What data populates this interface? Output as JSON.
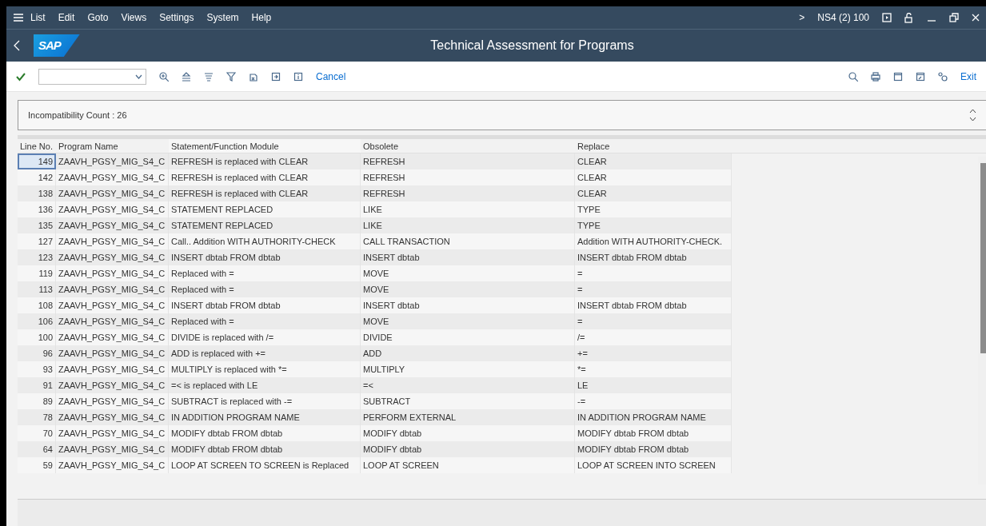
{
  "menu_bar": {
    "items": [
      "List",
      "Edit",
      "Goto",
      "Views",
      "Settings",
      "System",
      "Help"
    ],
    "system_arrow": ">",
    "system_info": "NS4 (2) 100"
  },
  "title_bar": {
    "logo": "SAP",
    "title": "Technical Assessment for Programs"
  },
  "toolbar": {
    "cancel": "Cancel",
    "exit": "Exit"
  },
  "header_panel": {
    "text": "Incompatibility Count : 26"
  },
  "table": {
    "columns": [
      "Line No.",
      "Program Name",
      "Statement/Function Module",
      "Obsolete",
      "Replace"
    ],
    "rows": [
      {
        "cells": [
          "149",
          "ZAAVH_PGSY_MIG_S4_C",
          "REFRESH is replaced with CLEAR",
          "REFRESH",
          "CLEAR"
        ],
        "selected": true
      },
      {
        "cells": [
          "142",
          "ZAAVH_PGSY_MIG_S4_C",
          "REFRESH is replaced with CLEAR",
          "REFRESH",
          "CLEAR"
        ],
        "selected": false
      },
      {
        "cells": [
          "138",
          "ZAAVH_PGSY_MIG_S4_C",
          "REFRESH is replaced with CLEAR",
          "REFRESH",
          "CLEAR"
        ],
        "selected": false
      },
      {
        "cells": [
          "136",
          "ZAAVH_PGSY_MIG_S4_C",
          "STATEMENT REPLACED",
          "LIKE",
          "TYPE"
        ],
        "selected": false
      },
      {
        "cells": [
          "135",
          "ZAAVH_PGSY_MIG_S4_C",
          "STATEMENT REPLACED",
          "LIKE",
          "TYPE"
        ],
        "selected": false
      },
      {
        "cells": [
          "127",
          "ZAAVH_PGSY_MIG_S4_C",
          "Call.. Addition WITH AUTHORITY-CHECK",
          "CALL TRANSACTION",
          "Addition WITH AUTHORITY-CHECK."
        ],
        "selected": false
      },
      {
        "cells": [
          "123",
          "ZAAVH_PGSY_MIG_S4_C",
          "INSERT dbtab FROM dbtab",
          "INSERT dbtab",
          "INSERT dbtab FROM dbtab"
        ],
        "selected": false
      },
      {
        "cells": [
          "119",
          "ZAAVH_PGSY_MIG_S4_C",
          "Replaced with =",
          "MOVE",
          "="
        ],
        "selected": false
      },
      {
        "cells": [
          "113",
          "ZAAVH_PGSY_MIG_S4_C",
          "Replaced with =",
          "MOVE",
          "="
        ],
        "selected": false
      },
      {
        "cells": [
          "108",
          "ZAAVH_PGSY_MIG_S4_C",
          "INSERT dbtab FROM dbtab",
          "INSERT dbtab",
          "INSERT dbtab FROM dbtab"
        ],
        "selected": false
      },
      {
        "cells": [
          "106",
          "ZAAVH_PGSY_MIG_S4_C",
          "Replaced with =",
          "MOVE",
          "="
        ],
        "selected": false
      },
      {
        "cells": [
          "100",
          "ZAAVH_PGSY_MIG_S4_C",
          "DIVIDE is replaced with /=",
          "DIVIDE",
          "/="
        ],
        "selected": false
      },
      {
        "cells": [
          "96",
          "ZAAVH_PGSY_MIG_S4_C",
          "ADD is replaced with +=",
          "ADD",
          "+="
        ],
        "selected": false
      },
      {
        "cells": [
          "93",
          "ZAAVH_PGSY_MIG_S4_C",
          "MULTIPLY is replaced with *=",
          "MULTIPLY",
          "*="
        ],
        "selected": false
      },
      {
        "cells": [
          "91",
          "ZAAVH_PGSY_MIG_S4_C",
          "=< is replaced with LE",
          "=<",
          "LE"
        ],
        "selected": false
      },
      {
        "cells": [
          "89",
          "ZAAVH_PGSY_MIG_S4_C",
          "SUBTRACT is replaced with -=",
          "SUBTRACT",
          "-="
        ],
        "selected": false
      },
      {
        "cells": [
          "78",
          "ZAAVH_PGSY_MIG_S4_C",
          "IN ADDITION PROGRAM NAME",
          "PERFORM EXTERNAL",
          "IN ADDITION PROGRAM NAME"
        ],
        "selected": false
      },
      {
        "cells": [
          "70",
          "ZAAVH_PGSY_MIG_S4_C",
          "MODIFY dbtab FROM dbtab",
          "MODIFY dbtab",
          "MODIFY dbtab FROM dbtab"
        ],
        "selected": false
      },
      {
        "cells": [
          "64",
          "ZAAVH_PGSY_MIG_S4_C",
          "MODIFY dbtab FROM dbtab",
          "MODIFY dbtab",
          "MODIFY dbtab FROM dbtab"
        ],
        "selected": false
      },
      {
        "cells": [
          "59",
          "ZAAVH_PGSY_MIG_S4_C",
          "LOOP AT SCREEN TO SCREEN is Replaced",
          "LOOP AT SCREEN",
          "LOOP AT SCREEN INTO SCREEN"
        ],
        "selected": false
      }
    ]
  }
}
